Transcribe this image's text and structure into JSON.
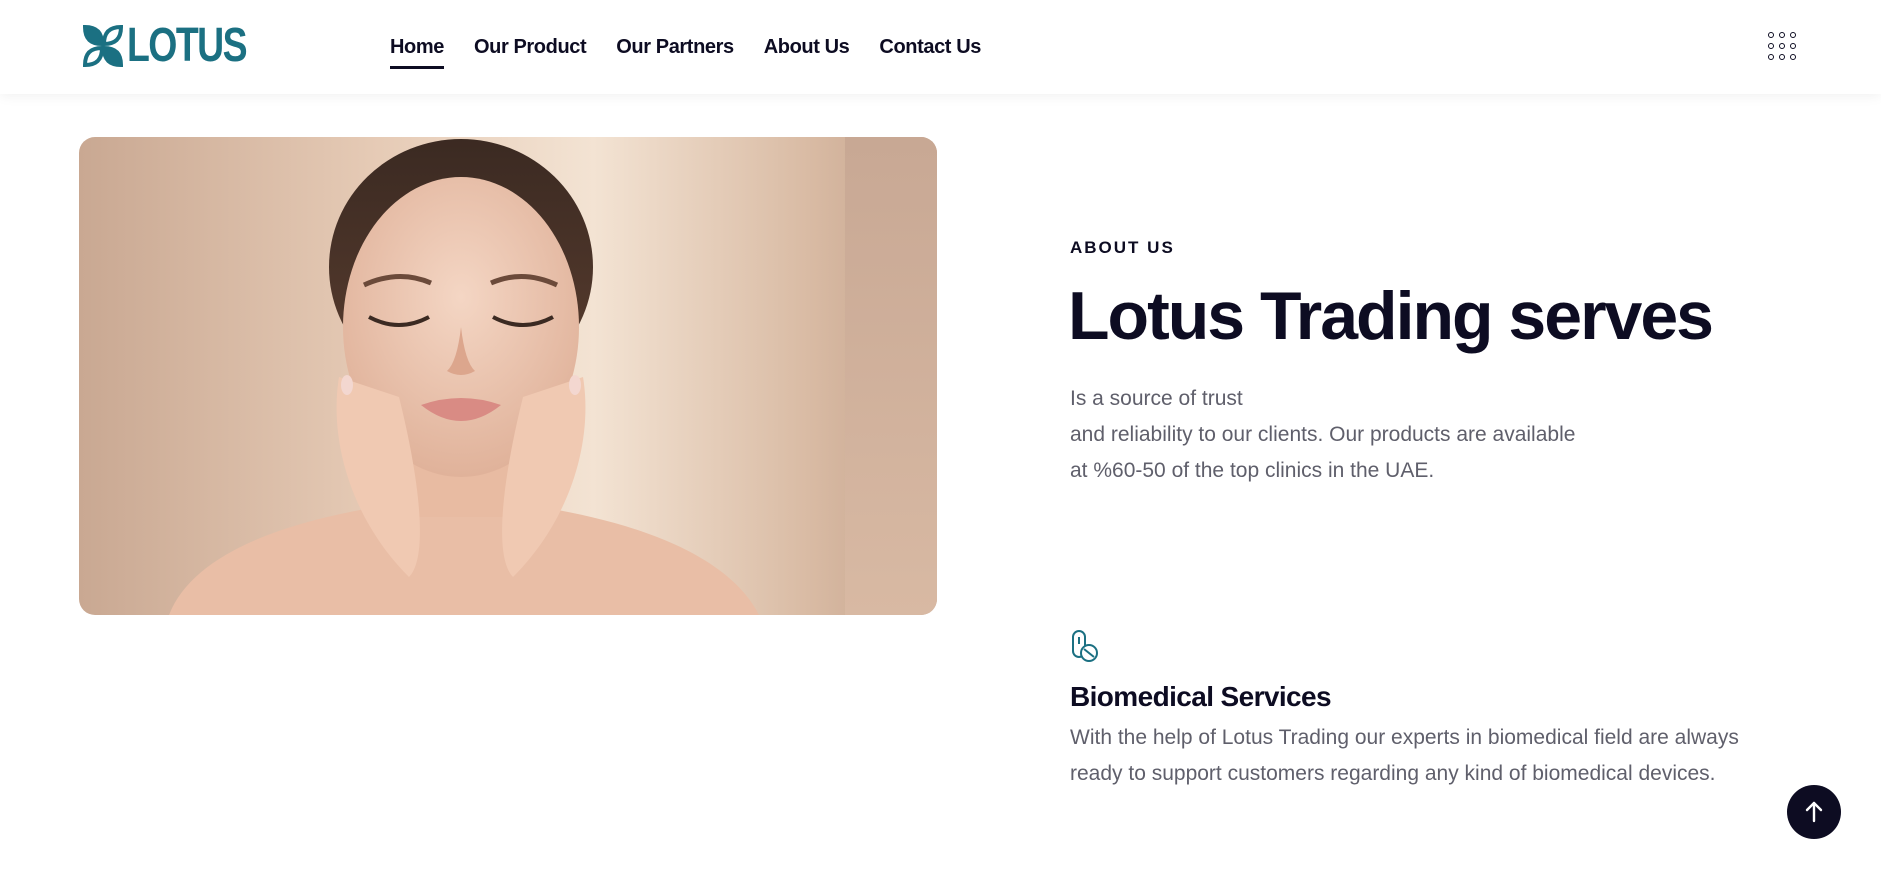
{
  "header": {
    "logo_text": "LOTUS",
    "nav": [
      {
        "label": "Home",
        "active": true
      },
      {
        "label": "Our Product",
        "active": false
      },
      {
        "label": "Our Partners",
        "active": false
      },
      {
        "label": "About Us",
        "active": false
      },
      {
        "label": "Contact Us",
        "active": false
      }
    ],
    "menu_icon": "grid-dots-icon"
  },
  "hero": {
    "image": "woman-skincare-portrait"
  },
  "about": {
    "label": "ABOUT US",
    "headline": "Lotus Trading serves",
    "description_lines": [
      "Is a source of trust",
      "and reliability to our clients. Our products are available",
      "at %60-50 of the top clinics in the UAE."
    ]
  },
  "service": {
    "icon": "pill-capsule-icon",
    "title": "Biomedical Services",
    "text": "With the help of Lotus Trading our experts in biomedical field are always ready to support customers regarding any kind of biomedical devices."
  },
  "scroll_top": {
    "icon": "arrow-up-icon"
  },
  "colors": {
    "brand": "#1b7082",
    "text_dark": "#0d0c22",
    "text_muted": "#5f5f6b"
  }
}
